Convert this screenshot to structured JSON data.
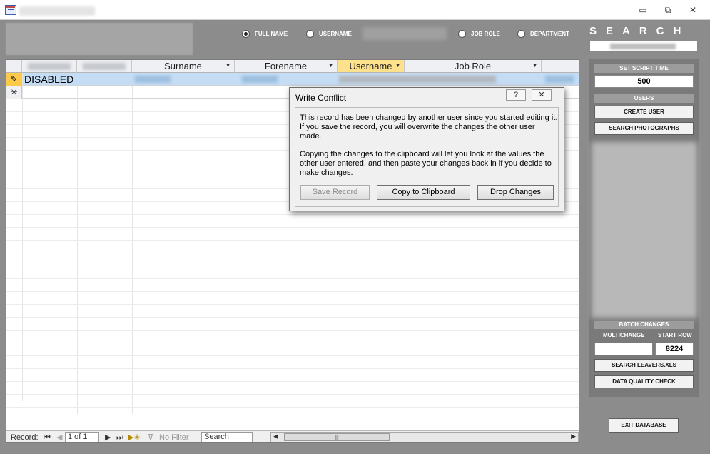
{
  "window": {
    "minimize_glyph": "▭",
    "restore_glyph": "⧉",
    "close_glyph": "✕"
  },
  "filters": {
    "options": [
      {
        "label": "FULL NAME",
        "selected": true
      },
      {
        "label": "USERNAME",
        "selected": false
      },
      {
        "label": "JOB ROLE",
        "selected": false
      },
      {
        "label": "DEPARTMENT",
        "selected": false
      }
    ]
  },
  "search_panel": {
    "title": "SEARCH"
  },
  "datasheet": {
    "columns": [
      "Surname",
      "Forename",
      "Username",
      "Job Role"
    ],
    "selected_column": "Username",
    "record": {
      "first_cell": "DISABLED"
    },
    "new_row_glyph": "✳",
    "pencil_glyph": "✎"
  },
  "navigation": {
    "record_label": "Record:",
    "position": "1 of 1",
    "no_filter": "No Filter",
    "search_box": "Search"
  },
  "dialog": {
    "title": "Write Conflict",
    "help_glyph": "?",
    "close_glyph": "✕",
    "message_1": "This record has been changed by another user since you started editing it.  If you save the record, you will overwrite the changes the other user made.",
    "message_2": "Copying the changes to the clipboard will let you look at the values the other user entered, and then paste your changes back in if you decide to make changes.",
    "buttons": {
      "save": "Save Record",
      "copy": "Copy to Clipboard",
      "drop": "Drop Changes"
    }
  },
  "side": {
    "set_script_time_label": "SET SCRIPT TIME",
    "script_time_value": "500",
    "users_label": "USERS",
    "create_user": "CREATE USER",
    "search_photographs": "SEARCH PHOTOGRAPHS",
    "batch_changes_label": "BATCH CHANGES",
    "multichange_label": "MULTICHANGE",
    "start_row_label": "START ROW",
    "multichange_value": "",
    "start_row_value": "8224",
    "search_leavers": "SEARCH LEAVERS.XLS",
    "data_quality": "DATA QUALITY CHECK",
    "exit": "EXIT DATABASE"
  }
}
